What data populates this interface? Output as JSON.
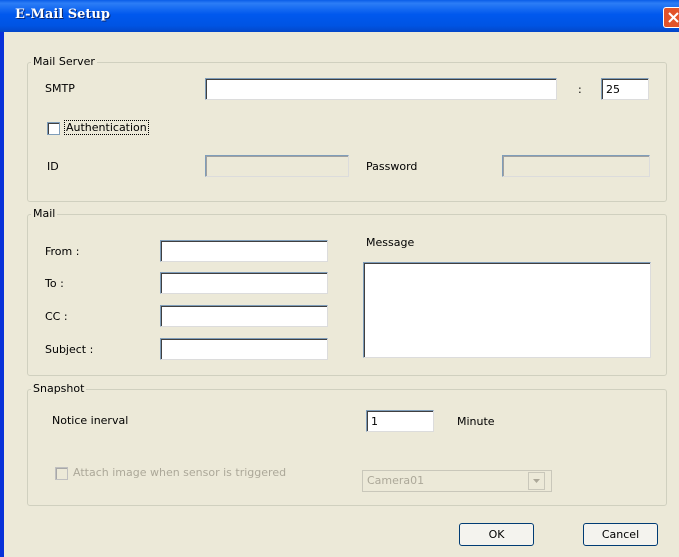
{
  "window": {
    "title": "E-Mail Setup"
  },
  "mail_server": {
    "legend": "Mail Server",
    "smtp_label": "SMTP",
    "smtp_value": "",
    "port_separator": ":",
    "port_value": "25",
    "auth_label": "Authentication",
    "auth_checked": false,
    "id_label": "ID",
    "id_value": "",
    "password_label": "Password",
    "password_value": ""
  },
  "mail": {
    "legend": "Mail",
    "from_label": "From :",
    "to_label": "To :",
    "cc_label": "CC :",
    "subject_label": "Subject :",
    "message_label": "Message",
    "from_value": "",
    "to_value": "",
    "cc_value": "",
    "subject_value": "",
    "message_value": ""
  },
  "snapshot": {
    "legend": "Snapshot",
    "notice_label": "Notice inerval",
    "interval_value": "1",
    "unit_label": "Minute",
    "attach_label": "Attach image when sensor is triggered",
    "attach_checked": false,
    "camera_selected": "Camera01"
  },
  "buttons": {
    "ok": "OK",
    "cancel": "Cancel"
  },
  "colors": {
    "titlebar": "#0054e3",
    "background": "#ece9d8",
    "close": "#e2532a"
  }
}
